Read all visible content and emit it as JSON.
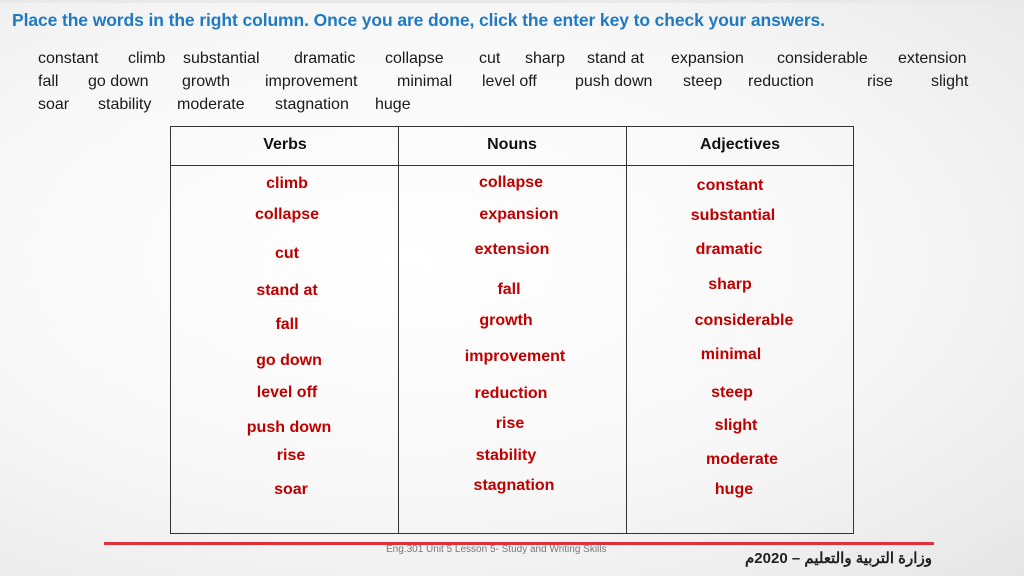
{
  "instruction": "Place the words in the right column. Once you are done, click the enter key to check your answers.",
  "word_bank": {
    "rows": [
      [
        "constant",
        "climb",
        "substantial",
        "dramatic",
        "collapse",
        "cut",
        "sharp",
        "stand at",
        "expansion",
        "considerable",
        "extension"
      ],
      [
        "fall",
        "go down",
        "growth",
        "improvement",
        "minimal",
        "level off",
        "push down",
        "steep",
        "reduction",
        "rise",
        "slight"
      ],
      [
        "soar",
        "stability",
        "moderate",
        "stagnation",
        "huge"
      ]
    ]
  },
  "table": {
    "headers": [
      "Verbs",
      "Nouns",
      "Adjectives"
    ],
    "columns": {
      "verbs": [
        "climb",
        "collapse",
        "cut",
        "stand at",
        "fall",
        "go down",
        "level off",
        "push down",
        "rise",
        "soar"
      ],
      "nouns": [
        "collapse",
        "expansion",
        "extension",
        "fall",
        "growth",
        "improvement",
        "reduction",
        "rise",
        "stability",
        "stagnation"
      ],
      "adjectives": [
        "constant",
        "substantial",
        "dramatic",
        "sharp",
        "considerable",
        "minimal",
        "steep",
        "slight",
        "moderate",
        "huge"
      ]
    }
  },
  "colors": {
    "title": "#1f7ac2",
    "answers": "#c00000",
    "footer_line": "#e0303a"
  },
  "footer": {
    "course": "Eng.301 Unit 5 Lesson 5- Study and Writing Skills",
    "ministry": "وزارة التربية والتعليم – 2020م"
  }
}
